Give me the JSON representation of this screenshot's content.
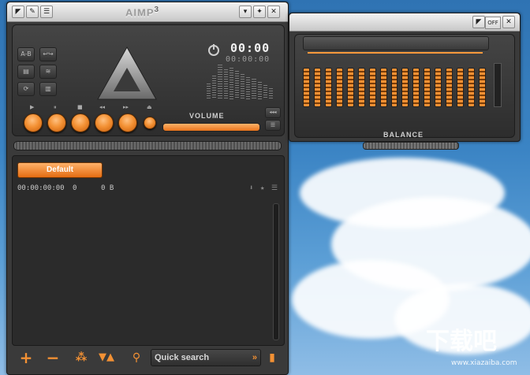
{
  "app": {
    "title": "AIMP",
    "version_mark": "3"
  },
  "titlebar": {
    "menu_icon": "menu-icon",
    "wrench_icon": "wrench-icon",
    "skin_icon": "skin-icon",
    "minimize_label": "▾",
    "pin_label": "✦",
    "close_label": "✕"
  },
  "player": {
    "time_main": "00:00",
    "time_sub": "00:00:00",
    "side_buttons": [
      "A-B",
      "↩↪",
      "▤",
      "≋",
      "⟳",
      "▥"
    ],
    "transport_labels": [
      "▶",
      "⏸",
      "■",
      "◂◂",
      "▸▸",
      "⏏"
    ],
    "volume_label": "VOLUME",
    "volume_level": 0.9
  },
  "playlist": {
    "tab_label": "Default",
    "duration": "00:00:00:00",
    "count": "0",
    "size": "0 B"
  },
  "bottom": {
    "add_label": "+",
    "remove_label": "−",
    "search_placeholder": "Quick search",
    "search_arrow": "»"
  },
  "equalizer": {
    "off_label": "OFF",
    "balance_label": "BALANCE",
    "bands": 17
  },
  "watermark": {
    "text": "下载吧",
    "url": "www.xiazaiba.com"
  }
}
